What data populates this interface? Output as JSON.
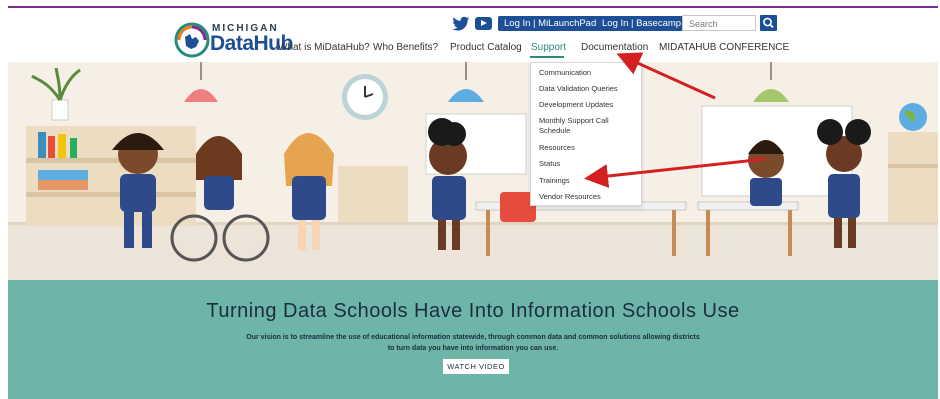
{
  "header": {
    "logo_top": "MICHIGAN",
    "logo_bottom": "DataHub",
    "login_milaunchpad": "Log In | MiLaunchPad",
    "login_basecamp": "Log In | Basecamp",
    "search_placeholder": "Search"
  },
  "nav": {
    "items": [
      "What is MiDataHub?",
      "Who Benefits?",
      "Product Catalog",
      "Support",
      "Documentation",
      "MIDATAHUB CONFERENCE"
    ],
    "active": "Support"
  },
  "dropdown": {
    "items": [
      "Communication",
      "Data Validation Queries",
      "Development Updates",
      "Monthly Support Call",
      "Schedule",
      "Resources",
      "Status",
      "Trainings",
      "Vendor Resources"
    ]
  },
  "banner": {
    "title": "Turning Data Schools Have Into Information Schools Use",
    "text_line1": "Our vision is to streamline the use of educational information statewide, through common data and common solutions allowing districts",
    "text_line2": "to turn data you have into information you can use.",
    "button": "WATCH VIDEO"
  },
  "colors": {
    "brand_blue": "#1c4f96",
    "accent_teal": "#2a8a7c",
    "banner_bg": "#6cb5a8",
    "annotation_red": "#d42020"
  },
  "icons": [
    "twitter-icon",
    "youtube-icon",
    "search-icon"
  ]
}
